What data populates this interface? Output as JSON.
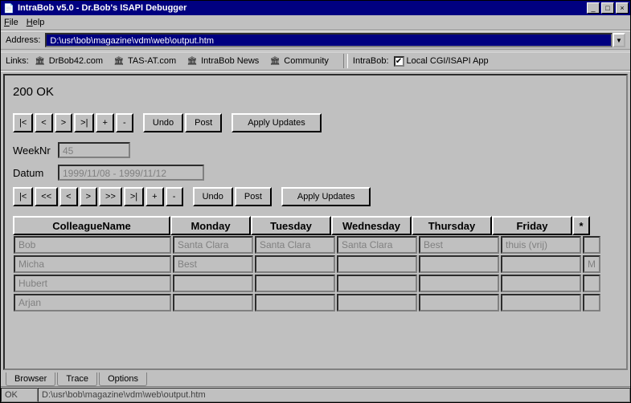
{
  "window": {
    "title": "IntraBob v5.0 - Dr.Bob's ISAPI Debugger"
  },
  "menu": {
    "file": "File",
    "help": "Help"
  },
  "addressbar": {
    "label": "Address:",
    "value": "D:\\usr\\bob\\magazine\\vdm\\web\\output.htm"
  },
  "links": {
    "label": "Links:",
    "items": [
      "DrBob42.com",
      "TAS-AT.com",
      "IntraBob News",
      "Community"
    ]
  },
  "intrabob": {
    "label": "IntraBob:",
    "checkbox_label": "Local CGI/ISAPI App",
    "checked": true
  },
  "page": {
    "status": "200 OK",
    "nav1": {
      "first": "|<",
      "prev": "<",
      "next": ">",
      "last": ">|",
      "plus": "+",
      "minus": "-",
      "undo": "Undo",
      "post": "Post",
      "apply": "Apply Updates"
    },
    "weeknr": {
      "label": "WeekNr",
      "value": "45"
    },
    "datum": {
      "label": "Datum",
      "value": "1999/11/08 - 1999/11/12"
    },
    "nav2": {
      "first": "|<",
      "pprev": "<<",
      "prev": "<",
      "next": ">",
      "nnext": ">>",
      "last": ">|",
      "plus": "+",
      "minus": "-",
      "undo": "Undo",
      "post": "Post",
      "apply": "Apply Updates"
    },
    "grid": {
      "headers": {
        "name": "ColleagueName",
        "mon": "Monday",
        "tue": "Tuesday",
        "wed": "Wednesday",
        "thu": "Thursday",
        "fri": "Friday",
        "tail": "*"
      },
      "rows": [
        {
          "name": "Bob",
          "mon": "Santa Clara",
          "tue": "Santa Clara",
          "wed": "Santa Clara",
          "thu": "Best",
          "fri": "thuis (vrij)",
          "tail": ""
        },
        {
          "name": "Micha",
          "mon": "Best",
          "tue": "",
          "wed": "",
          "thu": "",
          "fri": "",
          "tail": "M"
        },
        {
          "name": "Hubert",
          "mon": "",
          "tue": "",
          "wed": "",
          "thu": "",
          "fri": "",
          "tail": ""
        },
        {
          "name": "Arjan",
          "mon": "",
          "tue": "",
          "wed": "",
          "thu": "",
          "fri": "",
          "tail": ""
        }
      ]
    }
  },
  "tabs": {
    "browser": "Browser",
    "trace": "Trace",
    "options": "Options"
  },
  "statusbar": {
    "left": "OK",
    "right": "D:\\usr\\bob\\magazine\\vdm\\web\\output.htm"
  }
}
